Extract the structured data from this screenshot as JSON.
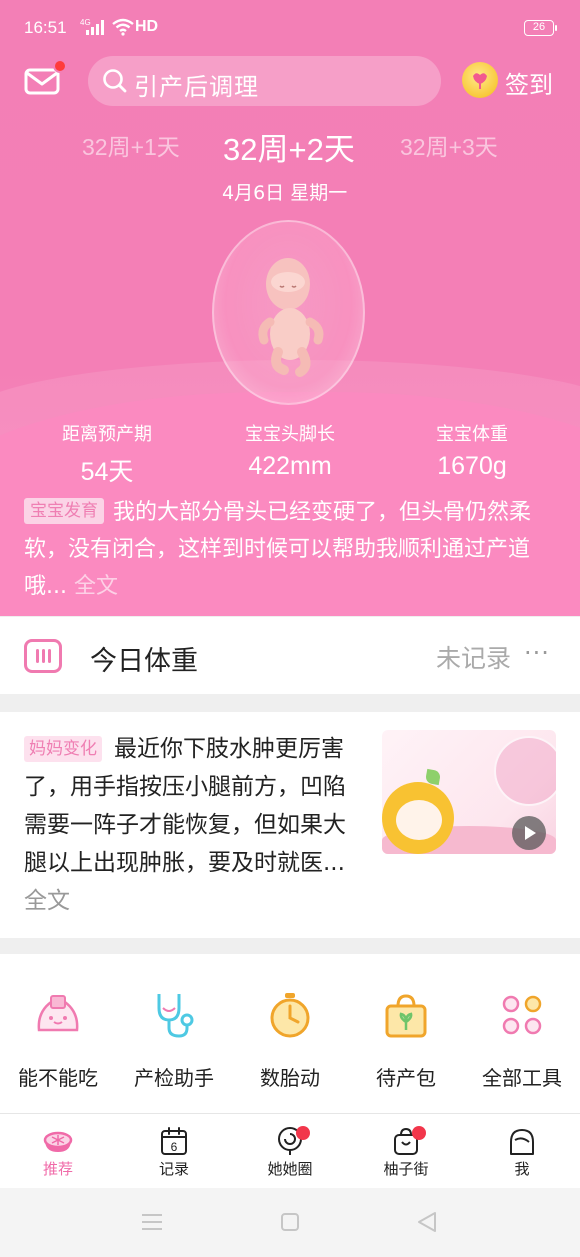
{
  "status_bar": {
    "time": "16:51",
    "network": "4G",
    "hd": "HD",
    "battery": "26"
  },
  "header": {
    "search_placeholder": "引产后调理",
    "signin_label": "签到"
  },
  "week_selector": {
    "prev": "32周+1天",
    "current": "32周+2天",
    "next": "32周+3天",
    "date": "4月6日 星期一"
  },
  "stats": [
    {
      "label": "距离预产期",
      "value": "54天"
    },
    {
      "label": "宝宝头脚长",
      "value": "422mm"
    },
    {
      "label": "宝宝体重",
      "value": "1670g"
    }
  ],
  "baby_development": {
    "tag": "宝宝发育",
    "text": "我的大部分骨头已经变硬了，但头骨仍然柔软，没有闭合，这样到时候可以帮助我顺利通过产道哦...",
    "more": "全文"
  },
  "weight": {
    "title": "今日体重",
    "status": "未记录",
    "more": "···"
  },
  "mom_change": {
    "tag": "妈妈变化",
    "text": "最近你下肢水肿更厉害了，用手指按压小腿前方，凹陷需要一阵子才能恢复，但如果大腿以上出现肿胀，要及时就医...",
    "more": "全文"
  },
  "tools": [
    {
      "label": "能不能吃",
      "icon": "food-icon"
    },
    {
      "label": "产检助手",
      "icon": "stethoscope-icon"
    },
    {
      "label": "数胎动",
      "icon": "timer-icon"
    },
    {
      "label": "待产包",
      "icon": "bag-icon"
    },
    {
      "label": "全部工具",
      "icon": "grid-icon"
    }
  ],
  "bottom_nav": [
    {
      "label": "推荐",
      "icon": "grapefruit-icon",
      "active": true
    },
    {
      "label": "记录",
      "icon": "calendar-icon",
      "calendar_day": "6"
    },
    {
      "label": "她她圈",
      "icon": "lollipop-icon",
      "badge": true
    },
    {
      "label": "柚子街",
      "icon": "shop-bag-icon",
      "badge": true
    },
    {
      "label": "我",
      "icon": "profile-icon"
    }
  ],
  "colors": {
    "brand_pink": "#f47fb6",
    "badge_red": "#f2364b",
    "tag_pink": "#ef7fb3"
  }
}
